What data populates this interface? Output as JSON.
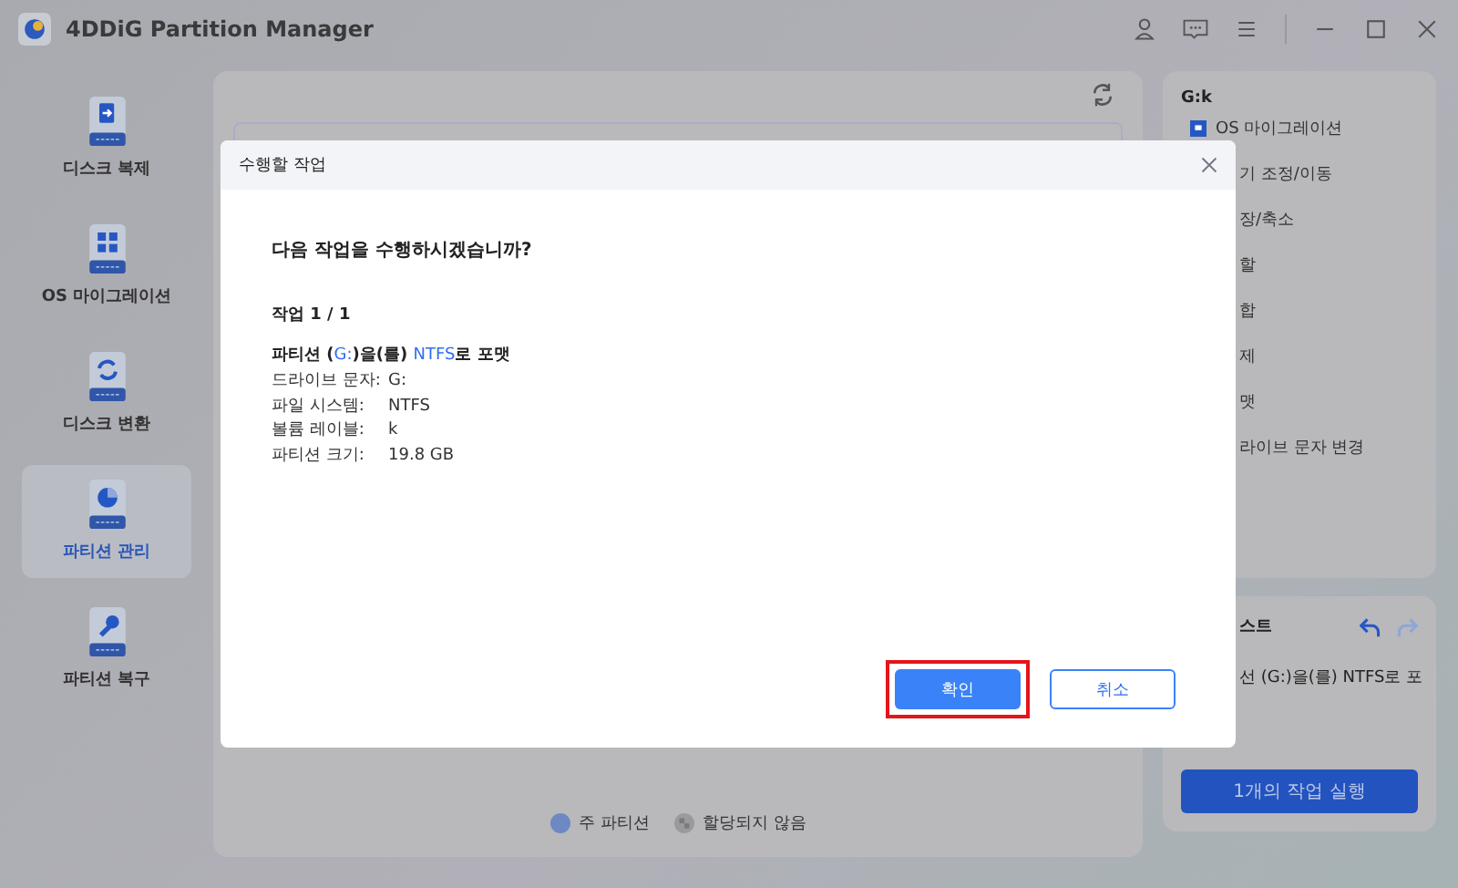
{
  "window": {
    "title": "4DDiG Partition Manager"
  },
  "sidebar": {
    "items": [
      {
        "label": "디스크 복제",
        "kind": "clone",
        "selected": false
      },
      {
        "label": "OS 마이그레이션",
        "kind": "migrate",
        "selected": false
      },
      {
        "label": "디스크 변환",
        "kind": "convert",
        "selected": false
      },
      {
        "label": "파티션 관리",
        "kind": "manage",
        "selected": true
      },
      {
        "label": "파티션 복구",
        "kind": "recover",
        "selected": false
      }
    ]
  },
  "legend": [
    {
      "label": "주 파티션",
      "kind": "primary"
    },
    {
      "label": "할당되지 않음",
      "kind": "unallocated"
    }
  ],
  "right_panel": {
    "title": "G:k",
    "items": [
      {
        "label": "OS 마이그레이션",
        "kind": "with-icon"
      },
      {
        "label": "기 조정/이동",
        "kind": "clipped"
      },
      {
        "label": "장/축소",
        "kind": "clipped"
      },
      {
        "label": "할",
        "kind": "clipped"
      },
      {
        "label": "합",
        "kind": "clipped"
      },
      {
        "label": "제",
        "kind": "clipped"
      },
      {
        "label": "맷",
        "kind": "clipped"
      },
      {
        "label": "라이브 문자 변경",
        "kind": "clipped"
      }
    ]
  },
  "task_panel": {
    "title": "스트",
    "tasks": [
      "선 (G:)을(를) NTFS로 포"
    ],
    "run_button": "1개의 작업 실행"
  },
  "dialog": {
    "title": "수행할 작업",
    "question": "다음 작업을 수행하시겠습니까?",
    "step": "작업 1 / 1",
    "operation": [
      {
        "text": "파티션 (",
        "highlight": false
      },
      {
        "text": "G:",
        "highlight": true
      },
      {
        "text": ")을(를) ",
        "highlight": false
      },
      {
        "text": "NTFS",
        "highlight": true
      },
      {
        "text": "로 포맷",
        "highlight": false
      }
    ],
    "details": [
      {
        "label": "드라이브 문자:",
        "value": "G:"
      },
      {
        "label": "파일 시스템:",
        "value": "NTFS"
      },
      {
        "label": "볼륨 레이블:",
        "value": "k"
      },
      {
        "label": "파티션 크기:",
        "value": "19.8 GB"
      }
    ],
    "buttons": [
      {
        "label": "확인",
        "kind": "primary",
        "highlighted": true
      },
      {
        "label": "취소",
        "kind": "secondary",
        "highlighted": false
      }
    ]
  }
}
